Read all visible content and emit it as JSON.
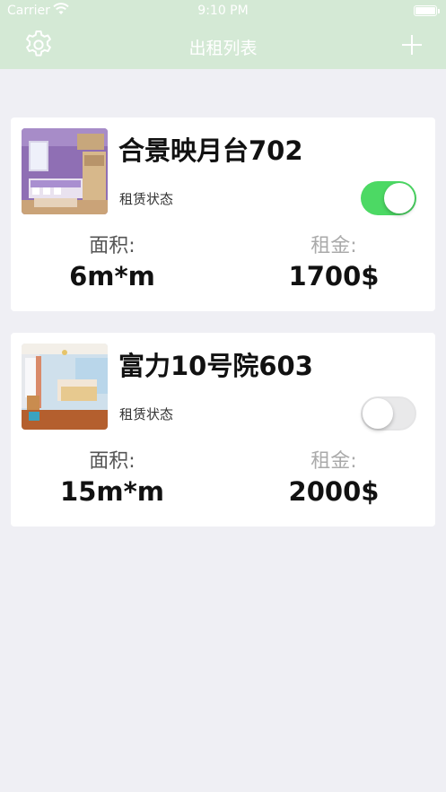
{
  "status_bar": {
    "carrier": "Carrier",
    "time": "9:10 PM"
  },
  "nav": {
    "title": "出租列表",
    "left_icon": "gear-icon",
    "right_icon": "plus-icon"
  },
  "colors": {
    "nav_bg": "#d4e9d5",
    "page_bg": "#efeff4",
    "toggle_on": "#4cd964"
  },
  "listings": [
    {
      "name": "合景映月台702",
      "status_label": "租赁状态",
      "rented": true,
      "area_label": "面积:",
      "area_value": "6m*m",
      "rent_label": "租金:",
      "rent_value": "1700$"
    },
    {
      "name": "富力10号院603",
      "status_label": "租赁状态",
      "rented": false,
      "area_label": "面积:",
      "area_value": "15m*m",
      "rent_label": "租金:",
      "rent_value": "2000$"
    }
  ]
}
